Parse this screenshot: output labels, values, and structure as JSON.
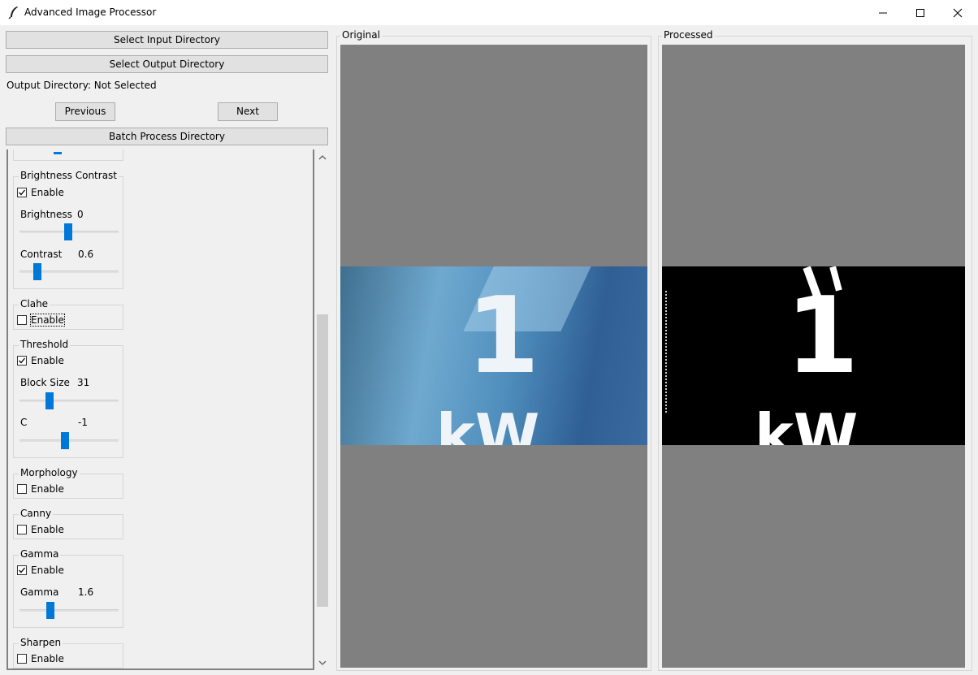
{
  "window": {
    "title": "Advanced Image Processor"
  },
  "controls": {
    "select_input": "Select Input Directory",
    "select_output": "Select Output Directory",
    "output_dir_label": "Output Directory: Not Selected",
    "previous": "Previous",
    "next": "Next",
    "batch": "Batch Process Directory"
  },
  "filters": {
    "brightness_contrast": {
      "title": "Brightness Contrast",
      "enable": "Enable",
      "enabled": true,
      "brightness_label": "Brightness",
      "brightness_value": "0",
      "contrast_label": "Contrast",
      "contrast_value": "0.6"
    },
    "clahe": {
      "title": "Clahe",
      "enable": "Enable",
      "enabled": false
    },
    "threshold": {
      "title": "Threshold",
      "enable": "Enable",
      "enabled": true,
      "block_size_label": "Block Size",
      "block_size_value": "31",
      "c_label": "C",
      "c_value": "-1"
    },
    "morphology": {
      "title": "Morphology",
      "enable": "Enable",
      "enabled": false
    },
    "canny": {
      "title": "Canny",
      "enable": "Enable",
      "enabled": false
    },
    "gamma": {
      "title": "Gamma",
      "enable": "Enable",
      "enabled": true,
      "gamma_label": "Gamma",
      "gamma_value": "1.6"
    },
    "sharpen": {
      "title": "Sharpen",
      "enable": "Enable",
      "enabled": false
    }
  },
  "panels": {
    "original": {
      "title": "Original",
      "digit": "1",
      "unit": "kW"
    },
    "processed": {
      "title": "Processed",
      "digit": "1",
      "unit": "kW"
    }
  },
  "colors": {
    "accent": "#0078d7",
    "canvas_bg": "#808080"
  },
  "icons": [
    "feather-icon",
    "minimize-icon",
    "maximize-icon",
    "close-icon",
    "checkmark-icon",
    "scroll-up-arrow-icon",
    "scroll-down-arrow-icon"
  ]
}
